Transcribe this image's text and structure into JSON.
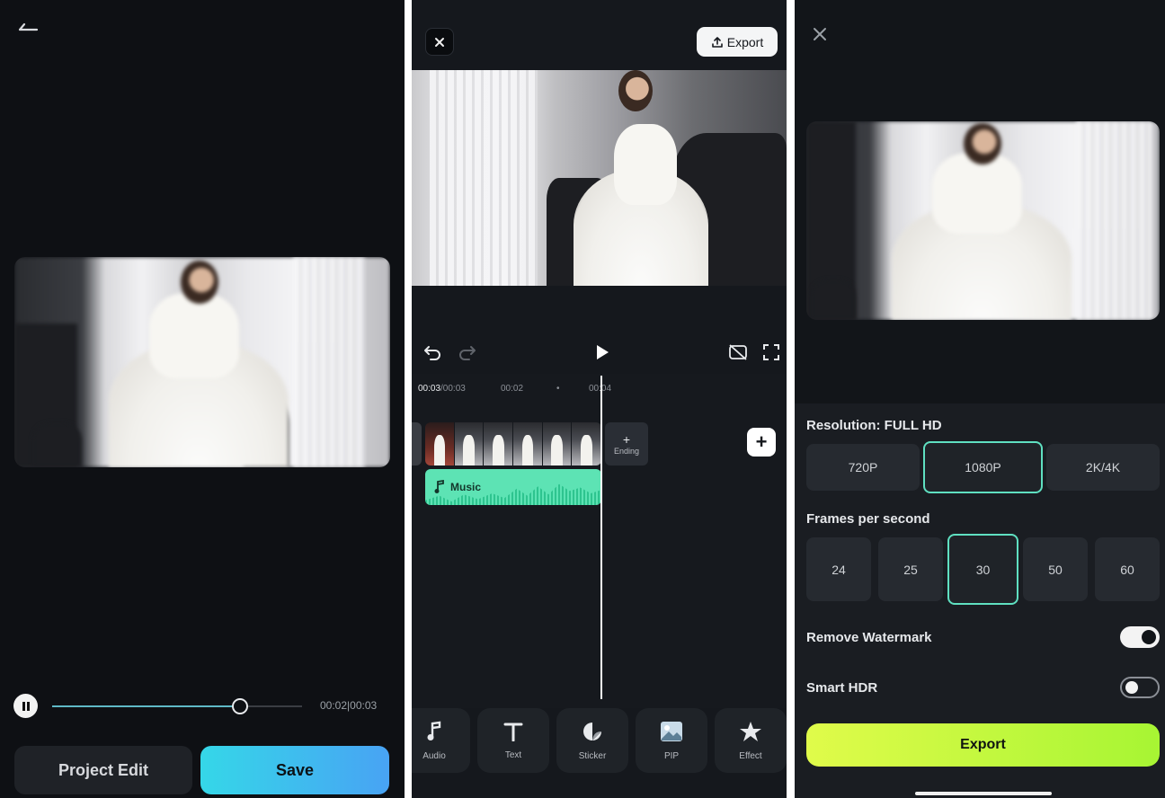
{
  "panel_editor_preview": {
    "time_display": "00:02|00:03",
    "playback_progress": 0.75,
    "project_edit_label": "Project Edit",
    "save_label": "Save"
  },
  "panel_timeline": {
    "export_label": "Export",
    "ruler": {
      "current": "00:03",
      "total": "/00:03",
      "mark1": "00:02",
      "dot": "•",
      "mark2": "00:04"
    },
    "ending_plus": "+",
    "ending_label": "Ending",
    "music_label": "Music",
    "add_label": "+",
    "tools": [
      "Audio",
      "Text",
      "Sticker",
      "PIP",
      "Effect"
    ]
  },
  "panel_export": {
    "resolution_title": "Resolution: FULL HD",
    "resolutions": [
      "720P",
      "1080P",
      "2K/4K"
    ],
    "selected_resolution": "1080P",
    "fps_title": "Frames per second",
    "fps_options": [
      "24",
      "25",
      "30",
      "50",
      "60"
    ],
    "selected_fps": "30",
    "watermark_label": "Remove Watermark",
    "watermark_on": true,
    "hdr_label": "Smart HDR",
    "hdr_on": false,
    "export_label": "Export"
  },
  "colors": {
    "accent_cyan": "#35d7e8",
    "accent_green": "#5fe0c1",
    "export_lime": "#c8f83c",
    "music_teal": "#5de3b4"
  }
}
